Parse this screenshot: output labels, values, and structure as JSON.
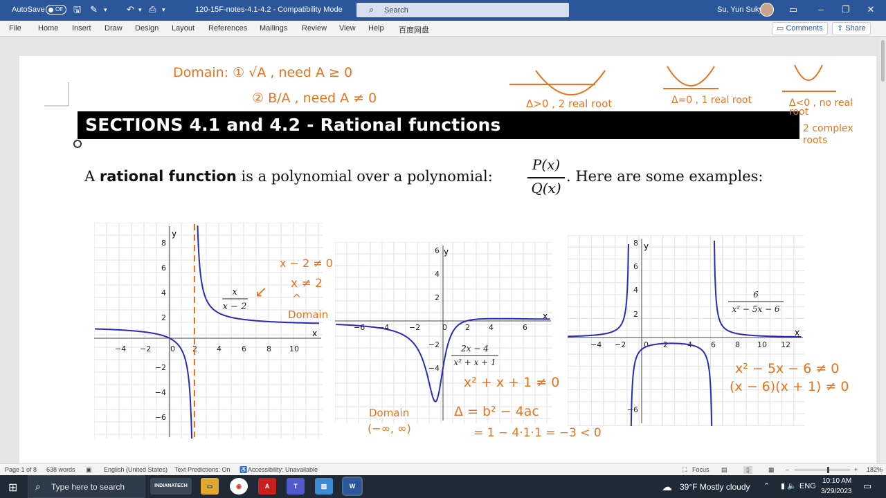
{
  "titlebar": {
    "autosave_label": "AutoSave",
    "autosave_state": "Off",
    "document_title": "120-15F-notes-4.1-4.2  -  Compatibility Mode",
    "search_placeholder": "Search",
    "user_name": "Su, Yun Suky"
  },
  "ribbon": {
    "tabs": [
      "File",
      "Home",
      "Insert",
      "Draw",
      "Design",
      "Layout",
      "References",
      "Mailings",
      "Review",
      "View",
      "Help",
      "百度网盘"
    ],
    "comments_label": "Comments",
    "share_label": "Share"
  },
  "document": {
    "section_heading": "SECTIONS 4.1 and 4.2 - Rational functions",
    "intro_prefix": "A",
    "intro_bold": "rational function",
    "intro_middle": "is a polynomial over a polynomial:",
    "frac_numerator": "P(x)",
    "frac_denominator": "Q(x)",
    "intro_suffix": ". Here are some examples:",
    "graphs": [
      {
        "formula_num": "x",
        "formula_den": "x − 2",
        "x_ticks": [
          "−4",
          "−2",
          "0",
          "2",
          "4",
          "6",
          "8",
          "10"
        ],
        "y_ticks": [
          "8",
          "6",
          "4",
          "2",
          "−2",
          "−4",
          "−6"
        ]
      },
      {
        "formula_num": "2x − 4",
        "formula_den": "x² + x + 1",
        "x_ticks": [
          "−6",
          "−4",
          "−2",
          "0",
          "2",
          "4",
          "6"
        ],
        "y_ticks": [
          "6",
          "4",
          "2",
          "−2",
          "−4"
        ]
      },
      {
        "formula_num": "6",
        "formula_den": "x² − 5x − 6",
        "x_ticks": [
          "−4",
          "−2",
          "0",
          "2",
          "4",
          "6",
          "8",
          "10",
          "12"
        ],
        "y_ticks": [
          "8",
          "6",
          "4",
          "2",
          "−6"
        ]
      }
    ],
    "axis_x": "x",
    "axis_y": "y"
  },
  "handwriting": {
    "domain_line1": "Domain:  ① √A  ,  need  A ≥ 0",
    "domain_line2": "② B/A  ,  need  A ≠ 0",
    "disc_pos": "Δ>0 , 2 real root",
    "disc_zero": "Δ=0 , 1 real root",
    "disc_neg": "Δ<0 , no real root",
    "complex_roots": "2 complex roots",
    "g1_note1": "x − 2 ≠ 0",
    "g1_note2": "x ≠ 2",
    "g1_note3": "Domain",
    "g2_note1": "x² + x + 1 ≠ 0",
    "g2_note2": "Δ = b² − 4ac",
    "g2_note3": "= 1 − 4·1·1 = −3 < 0",
    "g2_domain": "Domain",
    "g2_interval": "(−∞, ∞)",
    "g3_note1": "x² − 5x − 6 ≠ 0",
    "g3_note2": "(x − 6)(x + 1) ≠ 0"
  },
  "statusbar": {
    "page": "Page 1 of 8",
    "words": "638 words",
    "language": "English (United States)",
    "predictions": "Text Predictions: On",
    "accessibility": "Accessibility: Unavailable",
    "focus": "Focus",
    "zoom": "182%"
  },
  "taskbar": {
    "search_placeholder": "Type here to search",
    "app_badge": "INDIANATECH",
    "weather": "39°F  Mostly cloudy",
    "lang": "ENG",
    "time": "10:10 AM",
    "date": "3/29/2023"
  },
  "colors": {
    "word_blue": "#2b579a",
    "curve": "#2a2ab8",
    "ink": "#e8731c"
  }
}
